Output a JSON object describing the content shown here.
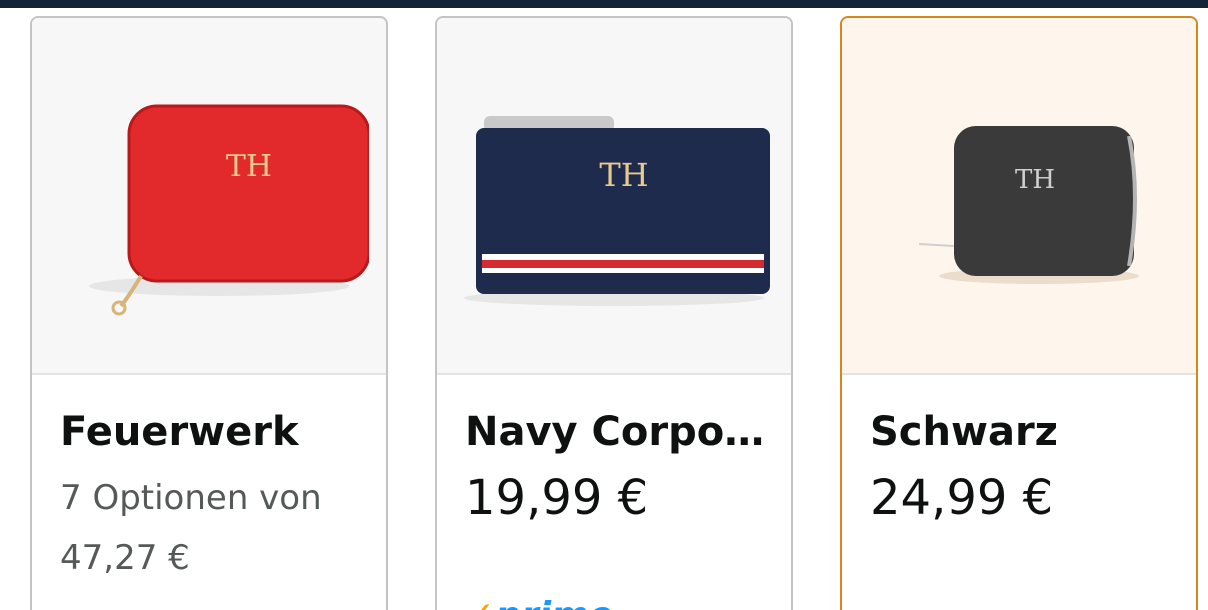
{
  "colors": {
    "topbar": "#13233a",
    "card_border": "#c4c4c4",
    "selected_border": "#d5871c",
    "selected_bg": "#fef6ec",
    "price_text": "#0f1111",
    "muted_text": "#565959",
    "prime_blue": "#1a98ff"
  },
  "variants": [
    {
      "name": "Feuerwerk",
      "options_text": "7 Optionen von",
      "options_price": "47,27 €",
      "image_icon": "red-wallet-icon",
      "selected": false
    },
    {
      "name": "Navy Corpo…",
      "price": "19,99 €",
      "prime_label": "prime",
      "image_icon": "navy-card-holder-icon",
      "selected": false
    },
    {
      "name": "Schwarz",
      "price": "24,99 €",
      "image_icon": "black-wallet-icon",
      "selected": true
    }
  ]
}
